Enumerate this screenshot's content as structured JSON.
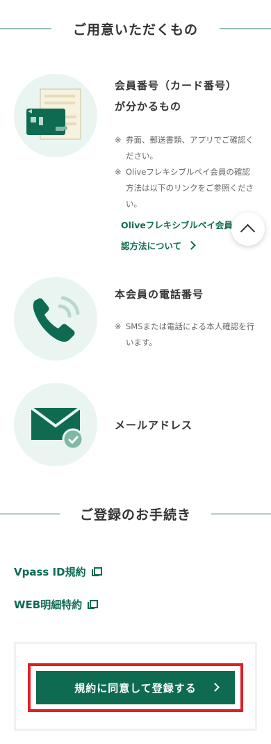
{
  "required_section": {
    "title": "ご用意いただくもの",
    "items": [
      {
        "icon": "membership-card-icon",
        "title_line1": "会員番号（カード番号）",
        "title_line2": "が分かるもの",
        "notes": [
          {
            "mark": "※",
            "text": "券面、郵送書類、アプリでご確認ください。"
          },
          {
            "mark": "※",
            "text": "Oliveフレキシブルペイ会員の確認方法は以下のリンクをご参照ください。"
          }
        ],
        "link_line1": "Oliveフレキシブルペイ会員の確",
        "link_line2": "認方法について"
      },
      {
        "icon": "phone-icon",
        "title_line1": "本会員の電話番号",
        "notes": [
          {
            "mark": "※",
            "text": "SMSまたは電話による本人確認を行います。"
          }
        ]
      },
      {
        "icon": "mail-icon",
        "title_line1": "メールアドレス"
      }
    ]
  },
  "procedure_section": {
    "title": "ご登録のお手続き",
    "links": [
      {
        "label": "Vpass ID規約",
        "icon": "external-link-icon"
      },
      {
        "label": "WEB明細特約",
        "icon": "external-link-icon"
      }
    ],
    "cta_label": "規約に同意して登録する"
  },
  "scroll_top_icon": "chevron-up-icon",
  "colors": {
    "brand_green": "#0e6b52",
    "icon_bg": "#eaf5f1",
    "highlight_red": "#e01e27"
  }
}
